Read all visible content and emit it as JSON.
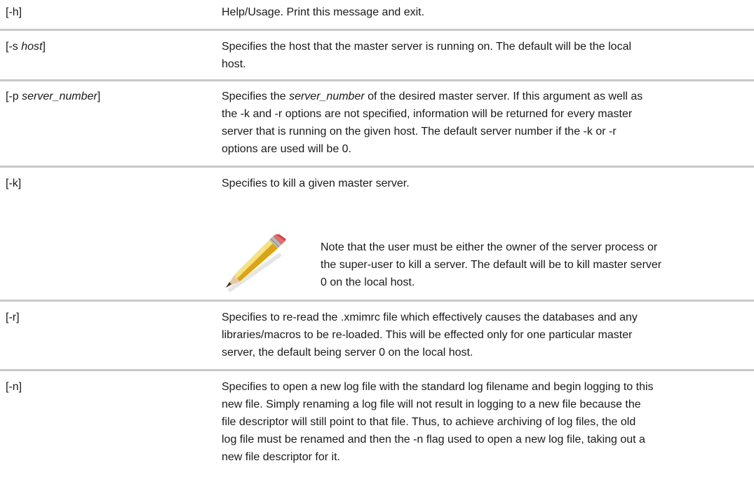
{
  "rows": [
    {
      "option": "[-h]",
      "desc": [
        "Help/Usage. Print this message and exit."
      ]
    },
    {
      "option_prefix": "[-s ",
      "option_arg": "host",
      "option_suffix": "]",
      "desc": [
        "Specifies the host that the master server is running on. The default will be the local",
        "host."
      ]
    },
    {
      "option_prefix": "[-p ",
      "option_arg": "server_number",
      "option_suffix": "]",
      "desc_first_prefix": "Specifies the ",
      "desc_first_italic": "server_number",
      "desc_first_suffix": " of the desired master server. If this argument as well as",
      "desc": [
        "the -k and -r options are not specified, information will be returned for every master",
        "server that is running on the given host. The default server number if the -k or -r",
        "options are used will be 0."
      ]
    },
    {
      "option": "[-k]",
      "desc": [
        "Specifies to kill a given master server."
      ],
      "note": [
        "Note that the user must be either the owner of the server process or",
        "the super-user to kill a server. The default will be to kill master server",
        "0 on the local host."
      ]
    },
    {
      "option": "[-r]",
      "desc": [
        "Specifies to re-read the .xmimrc file which effectively causes the databases and any",
        "libraries/macros to be re-loaded. This will be effected only for one particular master",
        "server, the default being server 0 on the local host."
      ]
    },
    {
      "option": "[-n]",
      "desc": [
        "Specifies to open a new log file with the standard log filename and begin logging to this",
        "new file. Simply renaming a log file will not result in logging to a new file because the",
        "file descriptor will still point to that file. Thus, to achieve archiving of log files, the old",
        "log file must be renamed and then the -n flag used to open a new log file, taking out a",
        "new file descriptor for it."
      ]
    }
  ]
}
